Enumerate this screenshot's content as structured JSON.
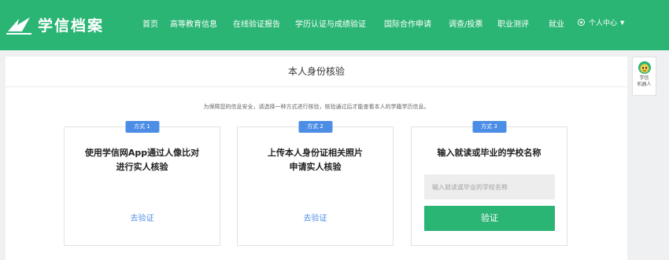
{
  "header": {
    "logo_text": "学信档案",
    "nav": [
      {
        "label": "首页"
      },
      {
        "label": "高等教育信息"
      },
      {
        "label": "在线验证报告"
      },
      {
        "label": "学历认证与成绩验证"
      },
      {
        "label": "国际合作申请"
      },
      {
        "label": "调查/投票"
      },
      {
        "label": "职业测评"
      },
      {
        "label": "就业"
      }
    ],
    "user_menu": "个人中心"
  },
  "panel": {
    "title": "本人身份核验",
    "intro": "为保障您的信息安全，请选择一种方式进行核验，核验通过后才能查看本人的学籍学历信息。",
    "cards": [
      {
        "badge": "方式 1",
        "title_line1": "使用学信网App通过人像比对",
        "title_line2": "进行实人核验",
        "link": "去验证"
      },
      {
        "badge": "方式 2",
        "title_line1": "上传本人身份证相关照片",
        "title_line2": "申请实人核验",
        "link": "去验证"
      },
      {
        "badge": "方式 3",
        "title_line1": "输入就读或毕业的学校名称",
        "input_placeholder": "输入就读或毕业的学校名称",
        "button": "验证"
      }
    ]
  },
  "robot": {
    "line1": "学信",
    "line2": "机器人"
  },
  "colors": {
    "brand_green": "#2bb574",
    "badge_blue": "#4c8ee6"
  }
}
